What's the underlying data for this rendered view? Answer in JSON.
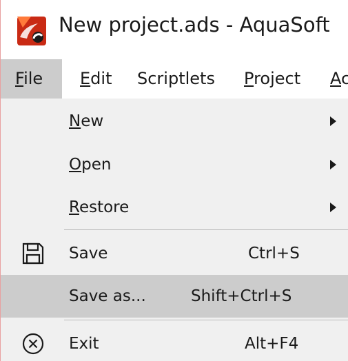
{
  "window": {
    "title": "New project.ads - AquaSoft",
    "app_icon": "aquasoft-logo-icon",
    "accent": "#e03a1e"
  },
  "menubar": {
    "items": [
      {
        "label_u": "F",
        "label_rest": "ile",
        "active": true
      },
      {
        "label_u": "E",
        "label_rest": "dit",
        "active": false
      },
      {
        "label_pre": "Scriptlets",
        "active": false
      },
      {
        "label_u": "P",
        "label_rest": "roject",
        "active": false
      },
      {
        "label_u": "A",
        "label_rest": "c",
        "active": false
      }
    ]
  },
  "file_menu": {
    "items": [
      {
        "label_u": "N",
        "label_rest": "ew",
        "submenu": true
      },
      {
        "label_u": "O",
        "label_rest": "pen",
        "submenu": true
      },
      {
        "label_u": "R",
        "label_rest": "estore",
        "submenu": true
      },
      {
        "label": "Save",
        "shortcut": "Ctrl+S",
        "icon": "save-icon"
      },
      {
        "label": "Save as...",
        "shortcut": "Shift+Ctrl+S",
        "highlighted": true
      },
      {
        "label": "Exit",
        "shortcut": "Alt+F4",
        "icon": "exit-icon"
      }
    ]
  }
}
